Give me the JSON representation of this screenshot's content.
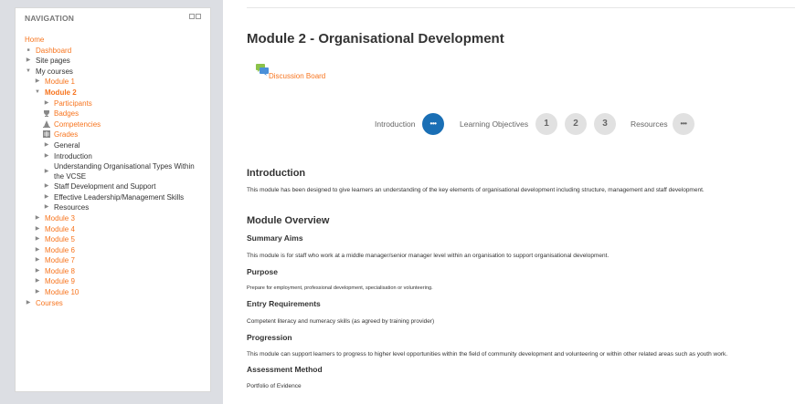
{
  "nav": {
    "title": "NAVIGATION",
    "items": [
      {
        "label": "Home"
      },
      {
        "label": "Dashboard"
      },
      {
        "label": "Site pages"
      },
      {
        "label": "My courses"
      },
      {
        "label": "Module 1"
      },
      {
        "label": "Module 2"
      },
      {
        "label": "Participants"
      },
      {
        "label": "Badges"
      },
      {
        "label": "Competencies"
      },
      {
        "label": "Grades"
      },
      {
        "label": "General"
      },
      {
        "label": "Introduction"
      },
      {
        "label": "Understanding Organisational Types Within the VCSE"
      },
      {
        "label": "Staff Development and Support"
      },
      {
        "label": "Effective Leadership/Management Skills"
      },
      {
        "label": "Resources"
      },
      {
        "label": "Module 3"
      },
      {
        "label": "Module 4"
      },
      {
        "label": "Module 5"
      },
      {
        "label": "Module 6"
      },
      {
        "label": "Module 7"
      },
      {
        "label": "Module 8"
      },
      {
        "label": "Module 9"
      },
      {
        "label": "Module 10"
      },
      {
        "label": "Courses"
      }
    ]
  },
  "main": {
    "title": "Module 2 - Organisational Development",
    "discussion_label": "Discussion Board",
    "progress": {
      "introduction_label": "Introduction",
      "objectives_label": "Learning Objectives",
      "resources_label": "Resources",
      "dots": "•••",
      "steps": [
        "1",
        "2",
        "3"
      ]
    },
    "intro_heading": "Introduction",
    "intro_text": "This module has been designed to give learners an understanding of the key elements of organisational development including structure, management and staff development.",
    "overview_heading": "Module Overview",
    "summary_heading": "Summary Aims",
    "summary_text": "This module is for staff who work at a middle manager/senior manager level within an organisation to support organisational development.",
    "purpose_heading": "Purpose",
    "purpose_text": "Prepare for employment, professional development, specialisation or volunteering.",
    "entry_heading": "Entry Requirements",
    "entry_text": "Competent literacy and numeracy skills (as agreed by training provider)",
    "progression_heading": "Progression",
    "progression_text": "This module can support learners to progress to higher level opportunities within the field of community development and volunteering or within other related areas such as youth work.",
    "assessment_heading": "Assessment Method",
    "assessment_text": "Portfolio of Evidence"
  },
  "colors": {
    "accent": "#f7751f",
    "active_step": "#1a6fb5",
    "sidebar_bg": "#dcdee3"
  }
}
